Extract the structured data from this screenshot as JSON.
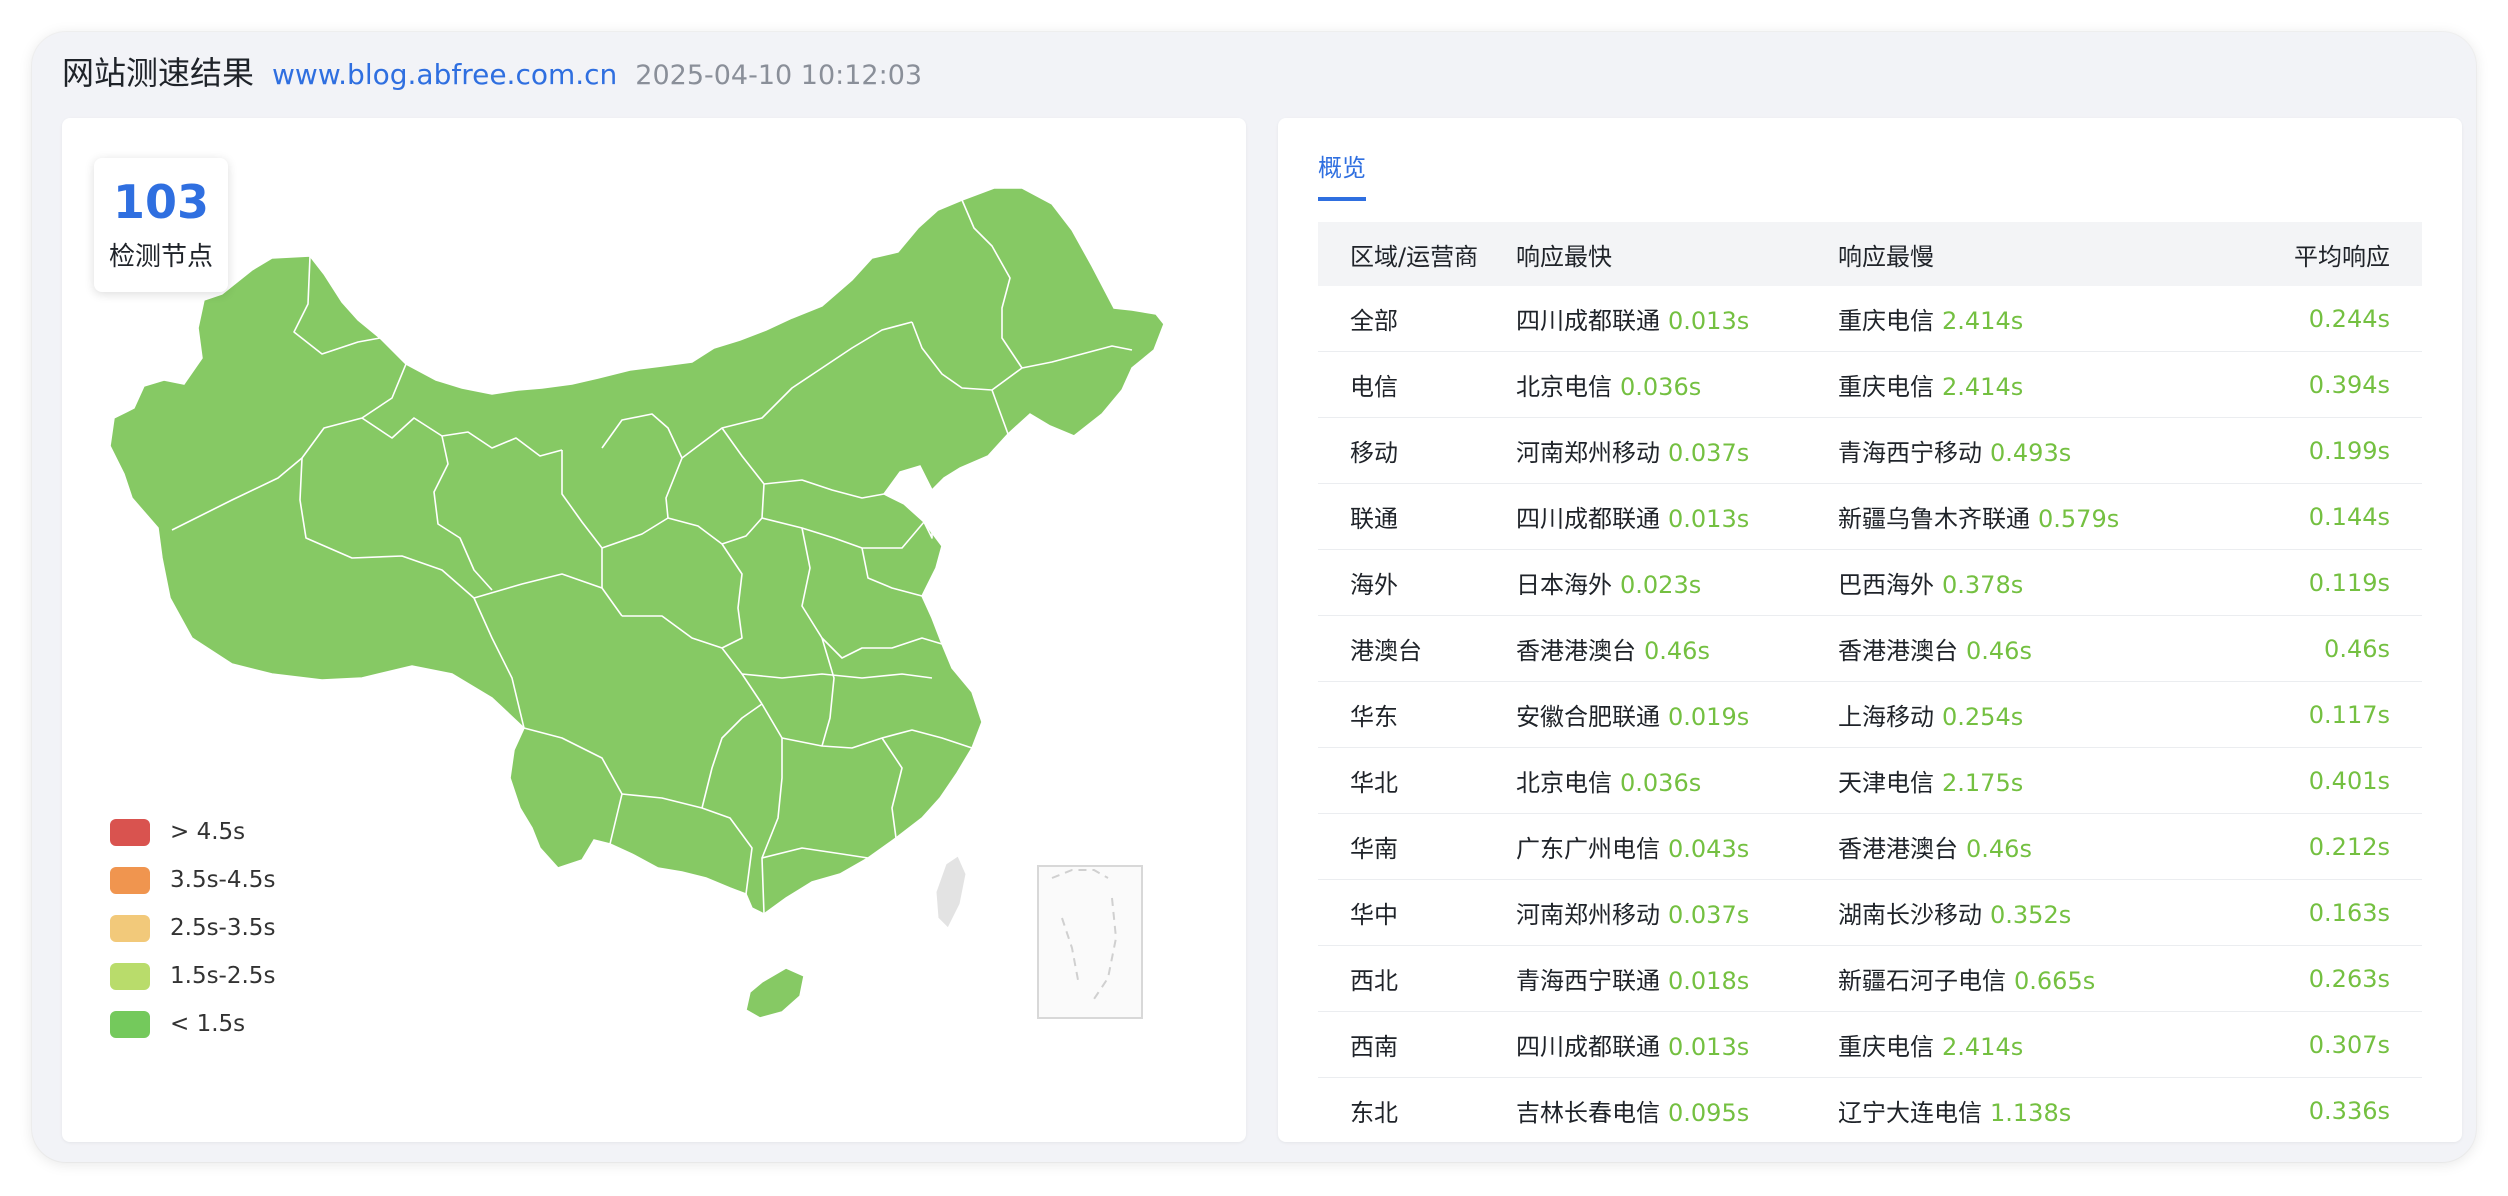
{
  "header": {
    "title": "网站测速结果",
    "url": "www.blog.abfree.com.cn",
    "time": "2025-04-10 10:12:03"
  },
  "summary": {
    "node_count": "103",
    "node_label": "检测节点"
  },
  "map": {
    "region_color": "#86c964",
    "border_color": "#ffffff"
  },
  "legend": [
    {
      "label": "> 4.5s",
      "color": "#d9534f"
    },
    {
      "label": "3.5s-4.5s",
      "color": "#f0954f"
    },
    {
      "label": "2.5s-3.5s",
      "color": "#f2c97a"
    },
    {
      "label": "1.5s-2.5s",
      "color": "#b9dc6b"
    },
    {
      "label": "< 1.5s",
      "color": "#74c95c"
    }
  ],
  "tabs": [
    {
      "label": "概览",
      "active": true
    }
  ],
  "table": {
    "headers": [
      "区域/运营商",
      "响应最快",
      "响应最慢",
      "平均响应"
    ],
    "rows": [
      {
        "region": "全部",
        "fast_name": "四川成都联通",
        "fast_val": "0.013s",
        "slow_name": "重庆电信",
        "slow_val": "2.414s",
        "avg": "0.244s"
      },
      {
        "region": "电信",
        "fast_name": "北京电信",
        "fast_val": "0.036s",
        "slow_name": "重庆电信",
        "slow_val": "2.414s",
        "avg": "0.394s"
      },
      {
        "region": "移动",
        "fast_name": "河南郑州移动",
        "fast_val": "0.037s",
        "slow_name": "青海西宁移动",
        "slow_val": "0.493s",
        "avg": "0.199s"
      },
      {
        "region": "联通",
        "fast_name": "四川成都联通",
        "fast_val": "0.013s",
        "slow_name": "新疆乌鲁木齐联通",
        "slow_val": "0.579s",
        "avg": "0.144s"
      },
      {
        "region": "海外",
        "fast_name": "日本海外",
        "fast_val": "0.023s",
        "slow_name": "巴西海外",
        "slow_val": "0.378s",
        "avg": "0.119s"
      },
      {
        "region": "港澳台",
        "fast_name": "香港港澳台",
        "fast_val": "0.46s",
        "slow_name": "香港港澳台",
        "slow_val": "0.46s",
        "avg": "0.46s"
      },
      {
        "region": "华东",
        "fast_name": "安徽合肥联通",
        "fast_val": "0.019s",
        "slow_name": "上海移动",
        "slow_val": "0.254s",
        "avg": "0.117s"
      },
      {
        "region": "华北",
        "fast_name": "北京电信",
        "fast_val": "0.036s",
        "slow_name": "天津电信",
        "slow_val": "2.175s",
        "avg": "0.401s"
      },
      {
        "region": "华南",
        "fast_name": "广东广州电信",
        "fast_val": "0.043s",
        "slow_name": "香港港澳台",
        "slow_val": "0.46s",
        "avg": "0.212s"
      },
      {
        "region": "华中",
        "fast_name": "河南郑州移动",
        "fast_val": "0.037s",
        "slow_name": "湖南长沙移动",
        "slow_val": "0.352s",
        "avg": "0.163s"
      },
      {
        "region": "西北",
        "fast_name": "青海西宁联通",
        "fast_val": "0.018s",
        "slow_name": "新疆石河子电信",
        "slow_val": "0.665s",
        "avg": "0.263s"
      },
      {
        "region": "西南",
        "fast_name": "四川成都联通",
        "fast_val": "0.013s",
        "slow_name": "重庆电信",
        "slow_val": "2.414s",
        "avg": "0.307s"
      },
      {
        "region": "东北",
        "fast_name": "吉林长春电信",
        "fast_val": "0.095s",
        "slow_name": "辽宁大连电信",
        "slow_val": "1.138s",
        "avg": "0.336s"
      }
    ]
  }
}
